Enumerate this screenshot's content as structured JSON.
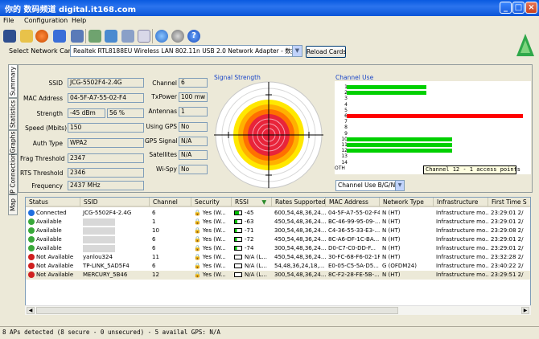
{
  "window": {
    "title": "你的 数码频道 digital.it168.com"
  },
  "menu": [
    "File",
    "Configuration",
    "Help"
  ],
  "toolbar_icons": [
    "save-icon",
    "open-folder-icon",
    "record-icon",
    "network-icon",
    "computer-icon",
    "play-icon",
    "map-icon",
    "checklist-icon",
    "document-icon",
    "globe-icon",
    "gps-icon",
    "help-icon"
  ],
  "select_network": {
    "label": "Select Network Card",
    "value": "Realtek RTL8188EU Wireless LAN 802.11n USB 2.0 Network Adapter - 数据包计划程",
    "reload_label": "Reload Cards"
  },
  "side_tabs": [
    "Summary",
    "Statistics",
    "Graphs",
    "IP Connection",
    "Map"
  ],
  "summary": {
    "ssid_label": "SSID",
    "ssid": "JCG-5502F4-2.4G",
    "mac_label": "MAC Address",
    "mac": "04-5F-A7-55-02-F4",
    "strength_label": "Strength",
    "strength_dbm": "-45 dBm",
    "strength_pct": "56 %",
    "speed_label": "Speed (Mbits)",
    "speed": "150",
    "auth_label": "Auth Type",
    "auth": "WPA2",
    "frag_label": "Frag Threshold",
    "frag": "2347",
    "rts_label": "RTS Threshold",
    "rts": "2346",
    "freq_label": "Frequency",
    "freq": "2437 MHz",
    "channel_label": "Channel",
    "channel": "6",
    "txpower_label": "TxPower",
    "txpower": "100 mw",
    "antennas_label": "Antennas",
    "antennas": "1",
    "usinggps_label": "Using GPS",
    "usinggps": "No",
    "gpssignal_label": "GPS Signal",
    "gpssignal": "N/A",
    "satellites_label": "Satellites",
    "satellites": "N/A",
    "wispy_label": "Wi-Spy",
    "wispy": "No"
  },
  "signal_strength": {
    "title": "Signal Strength"
  },
  "channel_use": {
    "title": "Channel Use",
    "channels": [
      "1",
      "2",
      "3",
      "4",
      "5",
      "6",
      "7",
      "8",
      "9",
      "10",
      "11",
      "12",
      "13",
      "14",
      "OTH"
    ],
    "usage": [
      {
        "channel": "1",
        "level": 0.45,
        "color": "#00d000"
      },
      {
        "channel": "2",
        "level": 0.45,
        "color": "#00d000"
      },
      {
        "channel": "6",
        "level": 1.0,
        "color": "#ff0000"
      },
      {
        "channel": "10",
        "level": 0.6,
        "color": "#00d000"
      },
      {
        "channel": "11",
        "level": 0.6,
        "color": "#00d000"
      },
      {
        "channel": "12",
        "level": 0.6,
        "color": "#00d000"
      }
    ],
    "tooltip": "Channel 12 - 1 access points",
    "band_select": "Channel Use B/G/N"
  },
  "table": {
    "columns": [
      "Status",
      "SSID",
      "Channel",
      "Security",
      "RSSI",
      "Rates Supported",
      "MAC Address",
      "Network Type",
      "Infrastructure",
      "First Time S"
    ],
    "rows": [
      {
        "status": "Connected",
        "status_color": "#1f6fe0",
        "ssid": "JCG-5502F4-2.4G",
        "channel": "6",
        "security": "Yes (W...",
        "signal": 0.6,
        "rssi": "-45",
        "rates": "600,54,48,36,24...",
        "mac": "04-5F-A7-55-02-F4",
        "type": "N (HT)",
        "infra": "Infrastructure mo...",
        "first": "23:29:01 2/"
      },
      {
        "status": "Available",
        "status_color": "#39a83a",
        "ssid": "",
        "channel": "1",
        "security": "Yes (W...",
        "signal": 0.4,
        "rssi": "-63",
        "rates": "450,54,48,36,24...",
        "mac": "BC-46-99-95-09-...",
        "type": "N (HT)",
        "infra": "Infrastructure mo...",
        "first": "23:29:01 2/"
      },
      {
        "status": "Available",
        "status_color": "#39a83a",
        "ssid": "",
        "channel": "10",
        "security": "Yes (W...",
        "signal": 0.3,
        "rssi": "-71",
        "rates": "300,54,48,36,24...",
        "mac": "C4-36-55-33-E3-...",
        "type": "N (HT)",
        "infra": "Infrastructure mo...",
        "first": "23:29:08 2/"
      },
      {
        "status": "Available",
        "status_color": "#39a83a",
        "ssid": "",
        "channel": "6",
        "security": "Yes (W...",
        "signal": 0.3,
        "rssi": "-72",
        "rates": "450,54,48,36,24...",
        "mac": "8C-A6-DF-1C-BA...",
        "type": "N (HT)",
        "infra": "Infrastructure mo...",
        "first": "23:29:01 2/"
      },
      {
        "status": "Available",
        "status_color": "#39a83a",
        "ssid": "",
        "channel": "6",
        "security": "Yes (W...",
        "signal": 0.3,
        "rssi": "-74",
        "rates": "300,54,48,36,24...",
        "mac": "D0-C7-C0-DD-F...",
        "type": "N (HT)",
        "infra": "Infrastructure mo...",
        "first": "23:29:01 2/"
      },
      {
        "status": "Not Available",
        "status_color": "#d02020",
        "ssid": "yanlou324",
        "channel": "11",
        "security": "Yes (W...",
        "signal": 0.0,
        "rssi": "N/A (L...",
        "rates": "450,54,48,36,24...",
        "mac": "30-FC-68-F6-02-1F",
        "type": "N (HT)",
        "infra": "Infrastructure mo...",
        "first": "23:32:28 2/"
      },
      {
        "status": "Not Available",
        "status_color": "#d02020",
        "ssid": "TP-LINK_5AD5F4",
        "channel": "6",
        "security": "Yes (W...",
        "signal": 0.0,
        "rssi": "N/A (L...",
        "rates": "54,48,36,24,18,...",
        "mac": "E0-05-C5-5A-D5...",
        "type": "G (OFDM24)",
        "infra": "Infrastructure mo...",
        "first": "23:40:22 2/"
      },
      {
        "status": "Not Available",
        "status_color": "#d02020",
        "ssid": "MERCURY_5B46",
        "channel": "12",
        "security": "Yes (W...",
        "signal": 0.0,
        "rssi": "N/A (L...",
        "rates": "300,54,48,36,24...",
        "mac": "8C-F2-28-FE-5B-...",
        "type": "N (HT)",
        "infra": "Infrastructure mo...",
        "first": "23:29:51 2/"
      }
    ]
  },
  "statusbar": {
    "text": "8 APs detected (8 secure - 0 unsecured) - 5 availal GPS: N/A"
  }
}
